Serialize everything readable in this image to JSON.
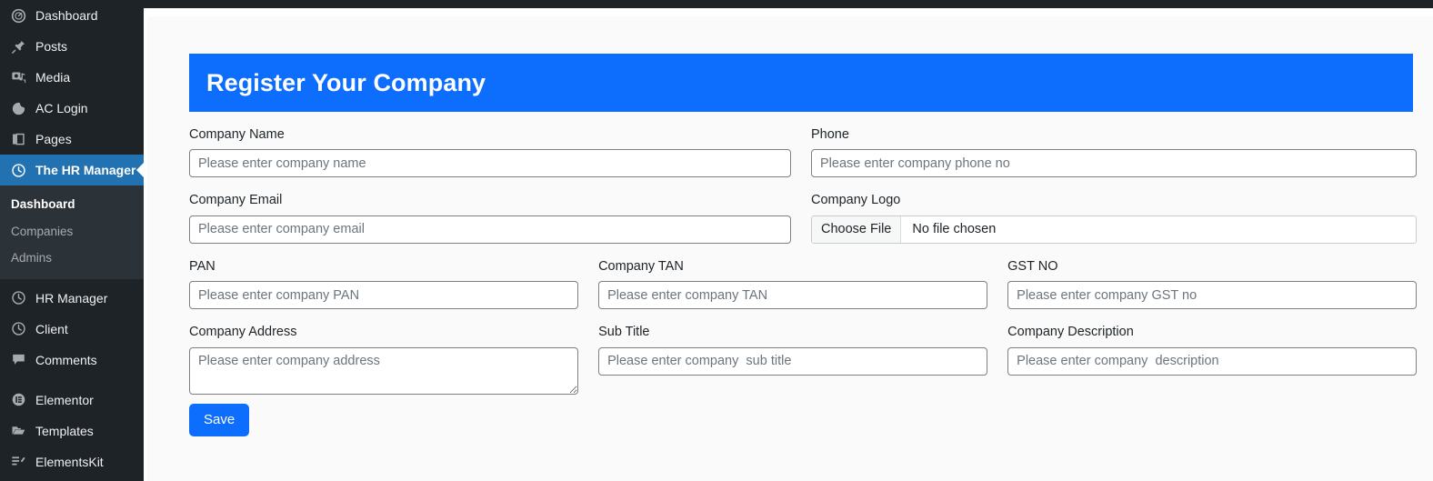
{
  "sidebar": {
    "items": [
      {
        "label": "Dashboard",
        "icon": "dashboard-gauge-icon",
        "state": "normal"
      },
      {
        "label": "Posts",
        "icon": "pushpin-icon",
        "state": "normal"
      },
      {
        "label": "Media",
        "icon": "media-icon",
        "state": "normal"
      },
      {
        "label": "AC Login",
        "icon": "ac-login-icon",
        "state": "normal"
      },
      {
        "label": "Pages",
        "icon": "pages-icon",
        "state": "normal"
      },
      {
        "label": "The HR Manager",
        "icon": "clock-icon",
        "state": "current"
      },
      {
        "label": "HR Manager",
        "icon": "clock-icon",
        "state": "normal"
      },
      {
        "label": "Client",
        "icon": "clock-icon",
        "state": "normal"
      },
      {
        "label": "Comments",
        "icon": "comment-icon",
        "state": "normal"
      },
      {
        "label": "Elementor",
        "icon": "elementor-icon",
        "state": "normal"
      },
      {
        "label": "Templates",
        "icon": "folder-icon",
        "state": "normal"
      },
      {
        "label": "ElementsKit",
        "icon": "elementskit-icon",
        "state": "normal"
      }
    ],
    "submenu": [
      {
        "label": "Dashboard",
        "active": true
      },
      {
        "label": "Companies",
        "active": false
      },
      {
        "label": "Admins",
        "active": false
      }
    ],
    "accent_color": "#2271b1",
    "background_color": "#1d2327",
    "submenu_background_color": "#2c3338"
  },
  "header": {
    "title": "Register Your Company",
    "background_color": "#0d6efd",
    "text_color": "#ffffff"
  },
  "form": {
    "row1": [
      {
        "label": "Company Name",
        "placeholder": "Please enter company name",
        "value": ""
      },
      {
        "label": "Phone",
        "placeholder": "Please enter company phone no",
        "value": ""
      }
    ],
    "row2": [
      {
        "label": "Company Email",
        "placeholder": "Please enter company email",
        "value": ""
      }
    ],
    "logo": {
      "label": "Company Logo",
      "button_label": "Choose File",
      "status": "No file chosen"
    },
    "row3": [
      {
        "label": "PAN",
        "placeholder": "Please enter company PAN",
        "value": ""
      },
      {
        "label": "Company TAN",
        "placeholder": "Please enter company TAN",
        "value": ""
      },
      {
        "label": "GST NO",
        "placeholder": "Please enter company GST no",
        "value": ""
      }
    ],
    "row4": [
      {
        "label": "Company Address",
        "placeholder": "Please enter company address",
        "value": ""
      },
      {
        "label": "Sub Title",
        "placeholder": "Please enter company  sub title",
        "value": ""
      },
      {
        "label": "Company Description",
        "placeholder": "Please enter company  description",
        "value": ""
      }
    ],
    "save_label": "Save",
    "save_color": "#0d6efd"
  }
}
